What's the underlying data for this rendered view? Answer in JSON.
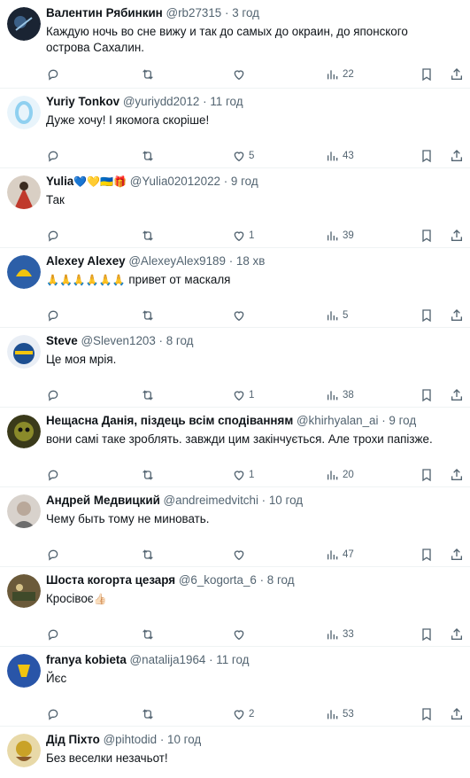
{
  "replies": [
    {
      "name": "Валентин Рябинкин",
      "handle": "@rb27315",
      "time": "3 год",
      "text": "Каждую ночь во сне вижу и так до самых до окраин, до японского острова Сахалин.",
      "likes": "",
      "retweets": "",
      "views": "22",
      "avatar_color": "#1a2433"
    },
    {
      "name": "Yuriy Tonkov",
      "handle": "@yuriydd2012",
      "time": "11 год",
      "text": "Дуже хочу! І якомога скоріше!",
      "likes": "5",
      "retweets": "",
      "views": "43",
      "avatar_color": "#8fd0f0"
    },
    {
      "name": "Yulia",
      "name_emoji": "💙💛🇺🇦🎁",
      "handle": "@Yulia02012022",
      "time": "9 год",
      "text": "Так",
      "likes": "1",
      "retweets": "",
      "views": "39",
      "avatar_color": "#c0392b"
    },
    {
      "name": "Alexey Alexey",
      "handle": "@AlexeyAlex9189",
      "time": "18 хв",
      "text_emoji": "🙏🙏🙏🙏🙏🙏",
      "text": "привет от маскаля",
      "likes": "",
      "retweets": "",
      "views": "5",
      "avatar_color": "#2c5fa8"
    },
    {
      "name": "Steve",
      "handle": "@Sleven1203",
      "time": "8 год",
      "text": "Це моя мрія.",
      "likes": "1",
      "retweets": "",
      "views": "38",
      "avatar_color": "#1d4f91"
    },
    {
      "name": "Нещасна Данія, піздець всім сподіванням",
      "handle": "@khirhyalan_ai",
      "time": "9 год",
      "text": "вони самі таке зроблять. завжди цим закінчується. Але трохи папізже.",
      "likes": "1",
      "retweets": "",
      "views": "20",
      "avatar_color": "#3a3a1a"
    },
    {
      "name": "Андрей Медвицкий",
      "handle": "@andreimedvitchi",
      "time": "10 год",
      "text": "Чему быть тому не миновать.",
      "likes": "",
      "retweets": "",
      "views": "47",
      "avatar_color": "#b9a89a"
    },
    {
      "name": "Шоста когорта цезаря",
      "handle": "@6_kogorta_6",
      "time": "8 год",
      "text": "Кросівоє",
      "text_suffix_emoji": "👍🏻",
      "likes": "",
      "retweets": "",
      "views": "33",
      "avatar_color": "#6b5a3a"
    },
    {
      "name": "franya kobieta",
      "handle": "@natalija1964",
      "time": "11 год",
      "text": "Йєс",
      "likes": "2",
      "retweets": "",
      "views": "53",
      "avatar_color": "#2955a8"
    },
    {
      "name": "Дід Піхто",
      "handle": "@pihtodid",
      "time": "10 год",
      "text": "Без веселки незачьот!",
      "avatar_color": "#c9a227"
    }
  ],
  "icons": {
    "reply": "reply-icon",
    "retweet": "retweet-icon",
    "like": "like-icon",
    "views": "views-icon",
    "bookmark": "bookmark-icon",
    "share": "share-icon"
  }
}
